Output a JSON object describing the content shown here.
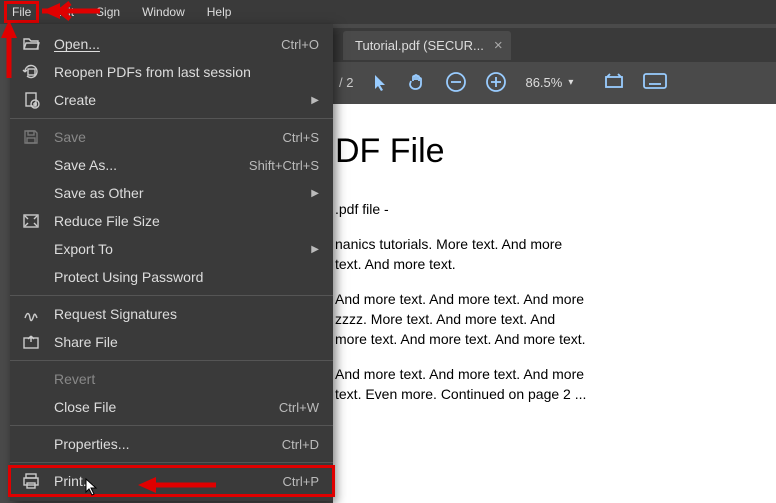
{
  "menubar": {
    "file": "File",
    "edit": "Edit",
    "sign": "Sign",
    "window": "Window",
    "help": "Help"
  },
  "tab": {
    "title": "Tutorial.pdf (SECUR..."
  },
  "toolbar": {
    "page": "/ 2",
    "zoom": "86.5%"
  },
  "menu": {
    "open": "Open...",
    "open_sc": "Ctrl+O",
    "reopen": "Reopen PDFs from last session",
    "create": "Create",
    "save": "Save",
    "save_sc": "Ctrl+S",
    "saveas": "Save As...",
    "saveas_sc": "Shift+Ctrl+S",
    "saveother": "Save as Other",
    "reduce": "Reduce File Size",
    "export": "Export To",
    "protect": "Protect Using Password",
    "reqsig": "Request Signatures",
    "share": "Share File",
    "revert": "Revert",
    "close": "Close File",
    "close_sc": "Ctrl+W",
    "props": "Properties...",
    "props_sc": "Ctrl+D",
    "print": "Print...",
    "print_sc": "Ctrl+P"
  },
  "doc": {
    "title": "DF File",
    "l1": ".pdf file -",
    "l2": "nanics tutorials. More text. And more",
    "l3": "text. And more text.",
    "l4": "And more text. And more text. And more",
    "l5": "zzzz. More text. And more text. And",
    "l6": "more text. And more text. And more text.",
    "l7": "And more text. And more text. And more",
    "l8": "text. Even more. Continued on page 2 ..."
  }
}
